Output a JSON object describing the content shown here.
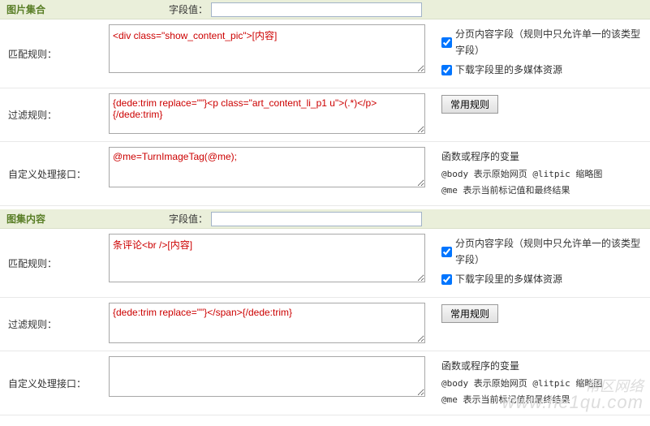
{
  "section1": {
    "title": "图片集合",
    "field_label": "字段值：",
    "field_value": "",
    "match": {
      "label": "匹配规则：",
      "content": "<div class=\"show_content_pic\">[内容]",
      "chk1_label": "分页内容字段（规则中只允许单一的该类型字段）",
      "chk2_label": "下载字段里的多媒体资源"
    },
    "filter": {
      "label": "过滤规则：",
      "content": "{dede:trim replace=\"\"}<p class=\"art_content_li_p1 u\">(.*)</p>{/dede:trim}",
      "btn": "常用规则"
    },
    "custom": {
      "label": "自定义处理接口：",
      "content": "@me=TurnImageTag(@me);",
      "help_head": "函数或程序的变量",
      "help1": "@body 表示原始网页 @litpic 缩略图",
      "help2": "@me 表示当前标记值和最终结果"
    }
  },
  "section2": {
    "title": "图集内容",
    "field_label": "字段值：",
    "field_value": "",
    "match": {
      "label": "匹配规则：",
      "content": "条评论<br />[内容]",
      "chk1_label": "分页内容字段（规则中只允许单一的该类型字段）",
      "chk2_label": "下载字段里的多媒体资源"
    },
    "filter": {
      "label": "过滤规则：",
      "content": "{dede:trim replace=\"\"}</span>{/dede:trim}",
      "btn": "常用规则"
    },
    "custom": {
      "label": "自定义处理接口：",
      "content": "",
      "help_head": "函数或程序的变量",
      "help1": "@body 表示原始网页 @litpic 缩略图",
      "help2": "@me 表示当前标记值和最终结果"
    }
  },
  "watermark": {
    "l1": "帮区网络",
    "l2": "www.he1qu.com"
  }
}
